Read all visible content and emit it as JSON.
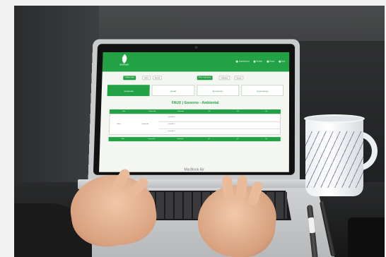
{
  "device": {
    "keyboard_brand": "MacBook Air"
  },
  "app": {
    "logo_text": "bonmob",
    "nav": [
      "Dashboard",
      "Profile",
      "Chart",
      "Exit"
    ],
    "toolbar": {
      "left_button": "Collect data",
      "left_select_1": "2021",
      "left_select_2": "Month",
      "right_button": "Filter indicators",
      "right_select_1": "Indicator",
      "right_select_2": "Scope"
    },
    "tabs": [
      "Ambiental",
      "Social",
      "Econômico",
      "Governança"
    ],
    "section_title": "FAUX | Governo - Ambiental",
    "table": {
      "headers": [
        "Pilar",
        "Dimensão",
        "Indicador",
        "Q1",
        "Q2",
        "Q3"
      ],
      "row_group": "Pilar 1",
      "row_sub": "Dimensão",
      "rows": [
        "Questão 1",
        "Questão 2",
        "Questão 3"
      ],
      "footer_headers": [
        "Pilar",
        "Dimensão",
        "Indicador",
        "Q1",
        "Q2",
        "Q3"
      ]
    }
  },
  "colors": {
    "brand_green": "#22a145",
    "screen_bg": "#f4f6f2"
  }
}
